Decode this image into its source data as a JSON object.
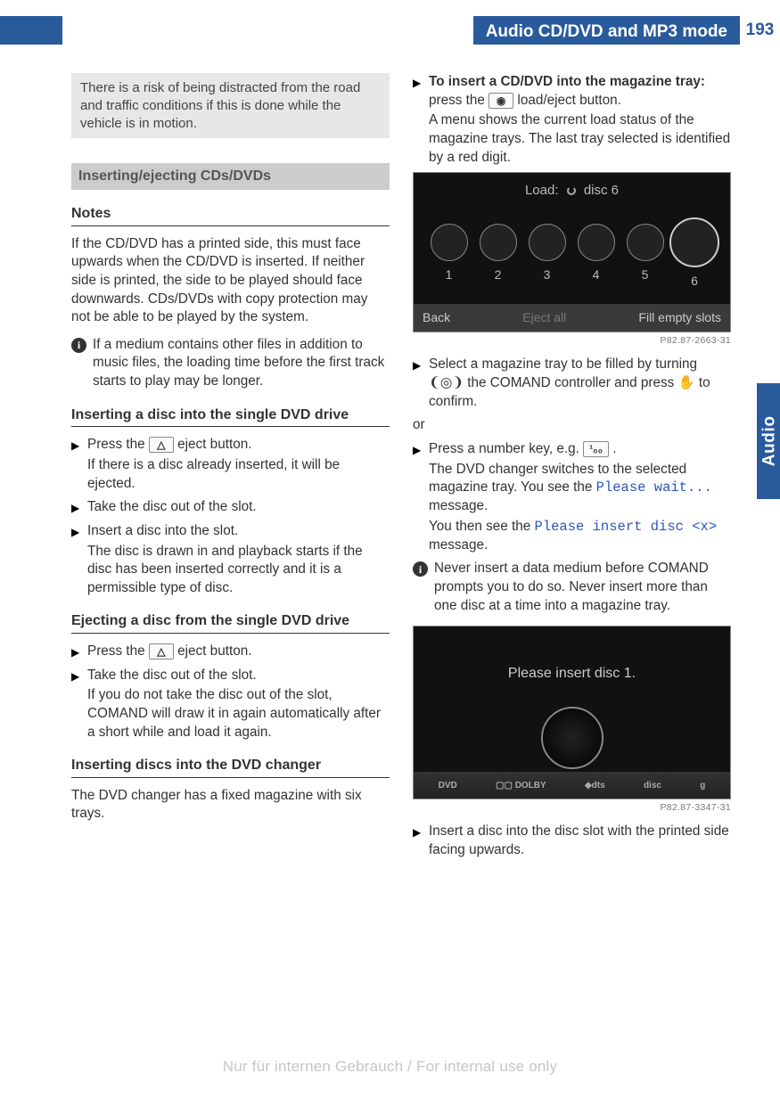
{
  "header": {
    "chapter_title": "Audio CD/DVD and MP3 mode",
    "page_number": "193",
    "side_tab": "Audio"
  },
  "note_box": "There is a risk of being distracted from the road and traffic conditions if this is done while the vehicle is in motion.",
  "sec_insert_eject": "Inserting/ejecting CDs/DVDs",
  "h_notes": "Notes",
  "p_notes": "If the CD/DVD has a printed side, this must face upwards when the CD/DVD is inserted. If neither side is printed, the side to be played should face downwards. CDs/DVDs with copy protection may not be able to be played by the system.",
  "info1": "If a medium contains other files in addition to music files, the loading time before the first track starts to play may be longer.",
  "h_insert_single": "Inserting a disc into the single DVD drive",
  "steps_insert_single": {
    "s1a": "Press the ",
    "s1_key": "△",
    "s1b": " eject button.",
    "s1_sub": "If there is a disc already inserted, it will be ejected.",
    "s2": "Take the disc out of the slot.",
    "s3": "Insert a disc into the slot.",
    "s3_sub": "The disc is drawn in and playback starts if the disc has been inserted correctly and it is a permissible type of disc."
  },
  "h_eject_single": "Ejecting a disc from the single DVD drive",
  "steps_eject_single": {
    "s1a": "Press the ",
    "s1_key": "△",
    "s1b": " eject button.",
    "s2": "Take the disc out of the slot.",
    "s2_sub": "If you do not take the disc out of the slot, COMAND will draw it in again automatically after a short while and load it again."
  },
  "h_insert_changer": "Inserting discs into the DVD changer",
  "p_changer_intro": "The DVD changer has a fixed magazine with six trays.",
  "steps_changer": {
    "s1": {
      "bold": "To insert a CD/DVD into the magazine tray:",
      "a": " press the ",
      "key": "◉",
      "b": " load/eject button.",
      "sub": "A menu shows the current load status of the magazine trays. The last tray selected is identified by a red digit."
    },
    "s2": {
      "a": "Select a magazine tray to be filled by turning ",
      "sym1": "❨◎❩",
      "b": " the COMAND controller and press ",
      "sym2": "✋",
      "c": " to confirm."
    },
    "or": "or",
    "s3": {
      "a": "Press a number key, e.g. ",
      "key": "¹₀₀",
      "b": ".",
      "sub1a": "The DVD changer switches to the selected magazine tray. You see the ",
      "tt1": "Please wait...",
      "sub1b": " message.",
      "sub2a": "You then see the ",
      "tt2": "Please insert disc <x>",
      "sub2b": " message."
    }
  },
  "info2": "Never insert a data medium before COMAND prompts you to do so. Never insert more than one disc at a time into a magazine tray.",
  "step_final": "Insert a disc into the disc slot with the printed side facing upwards.",
  "fig1": {
    "top_label": "Load:",
    "top_label2": "disc 6",
    "slots": [
      "1",
      "2",
      "3",
      "4",
      "5",
      "6"
    ],
    "bottom_left": "Back",
    "bottom_mid": "Eject all",
    "bottom_right": "Fill empty slots",
    "code": "P82.87-2663-31"
  },
  "fig2": {
    "text": "Please insert disc 1.",
    "logos": [
      "DVD",
      "▢▢ DOLBY",
      "◆dts",
      "disc",
      "g"
    ],
    "code": "P82.87-3347-31"
  },
  "watermark": "Nur für internen Gebrauch / For internal use only"
}
